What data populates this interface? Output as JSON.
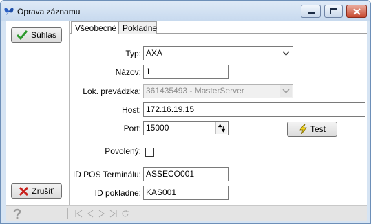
{
  "window": {
    "title": "Oprava záznamu"
  },
  "buttons": {
    "suhlas": "Súhlas",
    "zrusit": "Zrušiť",
    "test": "Test"
  },
  "tabs": [
    {
      "label": "Všeobecné",
      "active": true
    },
    {
      "label": "Pokladne",
      "active": false
    }
  ],
  "form": {
    "typ": {
      "label": "Typ:",
      "value": "AXA"
    },
    "nazov": {
      "label": "Názov:",
      "value": "1"
    },
    "lok_prevadzka": {
      "label": "Lok. prevádzka:",
      "value": "361435493 - MasterServer"
    },
    "host": {
      "label": "Host:",
      "value": "172.16.19.15"
    },
    "port": {
      "label": "Port:",
      "value": "15000"
    },
    "povoleny": {
      "label": "Povolený:",
      "checked": false
    },
    "id_pos": {
      "label": "ID POS Terminálu:",
      "value": "ASSECO001"
    },
    "id_pokladne": {
      "label": "ID pokladne:",
      "value": "KAS001"
    }
  },
  "icons": {
    "check": "check-icon",
    "cross": "cross-icon",
    "lightning": "lightning-icon",
    "help": "help-icon"
  },
  "colors": {
    "check_green": "#2e9a2e",
    "cross_red": "#c8201c",
    "lightning_yellow": "#f2d21a"
  }
}
